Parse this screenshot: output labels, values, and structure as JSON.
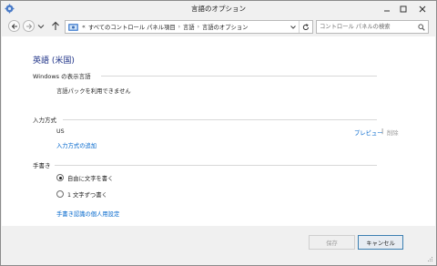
{
  "window": {
    "title": "言語のオプション"
  },
  "nav": {
    "breadcrumbs": [
      "すべてのコントロール パネル項目",
      "言語",
      "言語のオプション"
    ],
    "overflow": "«",
    "separator": "›",
    "search_placeholder": "コントロール パネルの検索"
  },
  "content": {
    "language_title": "英語 (米国)",
    "display_language": {
      "header": "Windows の表示言語",
      "status": "言語パックを利用できません"
    },
    "input_method": {
      "header": "入力方式",
      "item": "US",
      "preview_link": "プレビュー",
      "divider": "|",
      "remove_label": "削除",
      "add_link": "入力方式の追加"
    },
    "handwriting": {
      "header": "手書き",
      "options": [
        {
          "label": "自由に文字を書く",
          "selected": true
        },
        {
          "label": "1 文字ずつ書く",
          "selected": false
        }
      ],
      "personalize_link": "手書き認識の個人用設定"
    }
  },
  "buttons": {
    "save": "保存",
    "cancel": "キャンセル"
  },
  "colors": {
    "link": "#0066cc",
    "title": "#1e3287",
    "disabled": "#9a9a9a"
  }
}
